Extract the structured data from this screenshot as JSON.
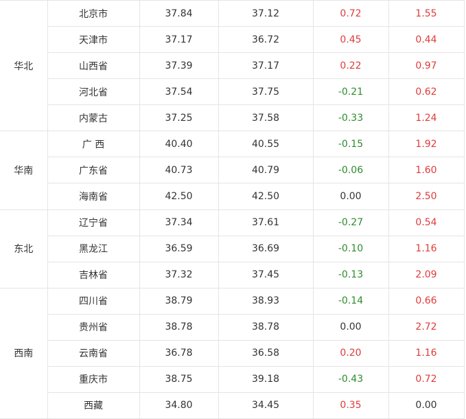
{
  "colors": {
    "positive": "#e03a3a",
    "negative": "#2e8b2e",
    "neutral": "#333333",
    "border": "#e4e4e4"
  },
  "regions": [
    {
      "name": "华北",
      "rows": [
        {
          "province": "北京市",
          "price_a": "37.84",
          "price_b": "37.12",
          "change": "0.72",
          "change_sign": "pos",
          "change2": "1.55",
          "change2_sign": "pos"
        },
        {
          "province": "天津市",
          "price_a": "37.17",
          "price_b": "36.72",
          "change": "0.45",
          "change_sign": "pos",
          "change2": "0.44",
          "change2_sign": "pos"
        },
        {
          "province": "山西省",
          "price_a": "37.39",
          "price_b": "37.17",
          "change": "0.22",
          "change_sign": "pos",
          "change2": "0.97",
          "change2_sign": "pos"
        },
        {
          "province": "河北省",
          "price_a": "37.54",
          "price_b": "37.75",
          "change": "-0.21",
          "change_sign": "neg",
          "change2": "0.62",
          "change2_sign": "pos"
        },
        {
          "province": "内蒙古",
          "price_a": "37.25",
          "price_b": "37.58",
          "change": "-0.33",
          "change_sign": "neg",
          "change2": "1.24",
          "change2_sign": "pos"
        }
      ]
    },
    {
      "name": "华南",
      "rows": [
        {
          "province": "广 西",
          "price_a": "40.40",
          "price_b": "40.55",
          "change": "-0.15",
          "change_sign": "neg",
          "change2": "1.92",
          "change2_sign": "pos"
        },
        {
          "province": "广东省",
          "price_a": "40.73",
          "price_b": "40.79",
          "change": "-0.06",
          "change_sign": "neg",
          "change2": "1.60",
          "change2_sign": "pos"
        },
        {
          "province": "海南省",
          "price_a": "42.50",
          "price_b": "42.50",
          "change": "0.00",
          "change_sign": "zero",
          "change2": "2.50",
          "change2_sign": "pos"
        }
      ]
    },
    {
      "name": "东北",
      "rows": [
        {
          "province": "辽宁省",
          "price_a": "37.34",
          "price_b": "37.61",
          "change": "-0.27",
          "change_sign": "neg",
          "change2": "0.54",
          "change2_sign": "pos"
        },
        {
          "province": "黑龙江",
          "price_a": "36.59",
          "price_b": "36.69",
          "change": "-0.10",
          "change_sign": "neg",
          "change2": "1.16",
          "change2_sign": "pos"
        },
        {
          "province": "吉林省",
          "price_a": "37.32",
          "price_b": "37.45",
          "change": "-0.13",
          "change_sign": "neg",
          "change2": "2.09",
          "change2_sign": "pos"
        }
      ]
    },
    {
      "name": "西南",
      "rows": [
        {
          "province": "四川省",
          "price_a": "38.79",
          "price_b": "38.93",
          "change": "-0.14",
          "change_sign": "neg",
          "change2": "0.66",
          "change2_sign": "pos"
        },
        {
          "province": "贵州省",
          "price_a": "38.78",
          "price_b": "38.78",
          "change": "0.00",
          "change_sign": "zero",
          "change2": "2.72",
          "change2_sign": "pos"
        },
        {
          "province": "云南省",
          "price_a": "36.78",
          "price_b": "36.58",
          "change": "0.20",
          "change_sign": "pos",
          "change2": "1.16",
          "change2_sign": "pos"
        },
        {
          "province": "重庆市",
          "price_a": "38.75",
          "price_b": "39.18",
          "change": "-0.43",
          "change_sign": "neg",
          "change2": "0.72",
          "change2_sign": "pos"
        },
        {
          "province": "西藏",
          "price_a": "34.80",
          "price_b": "34.45",
          "change": "0.35",
          "change_sign": "pos",
          "change2": "0.00",
          "change2_sign": "zero"
        }
      ]
    }
  ]
}
